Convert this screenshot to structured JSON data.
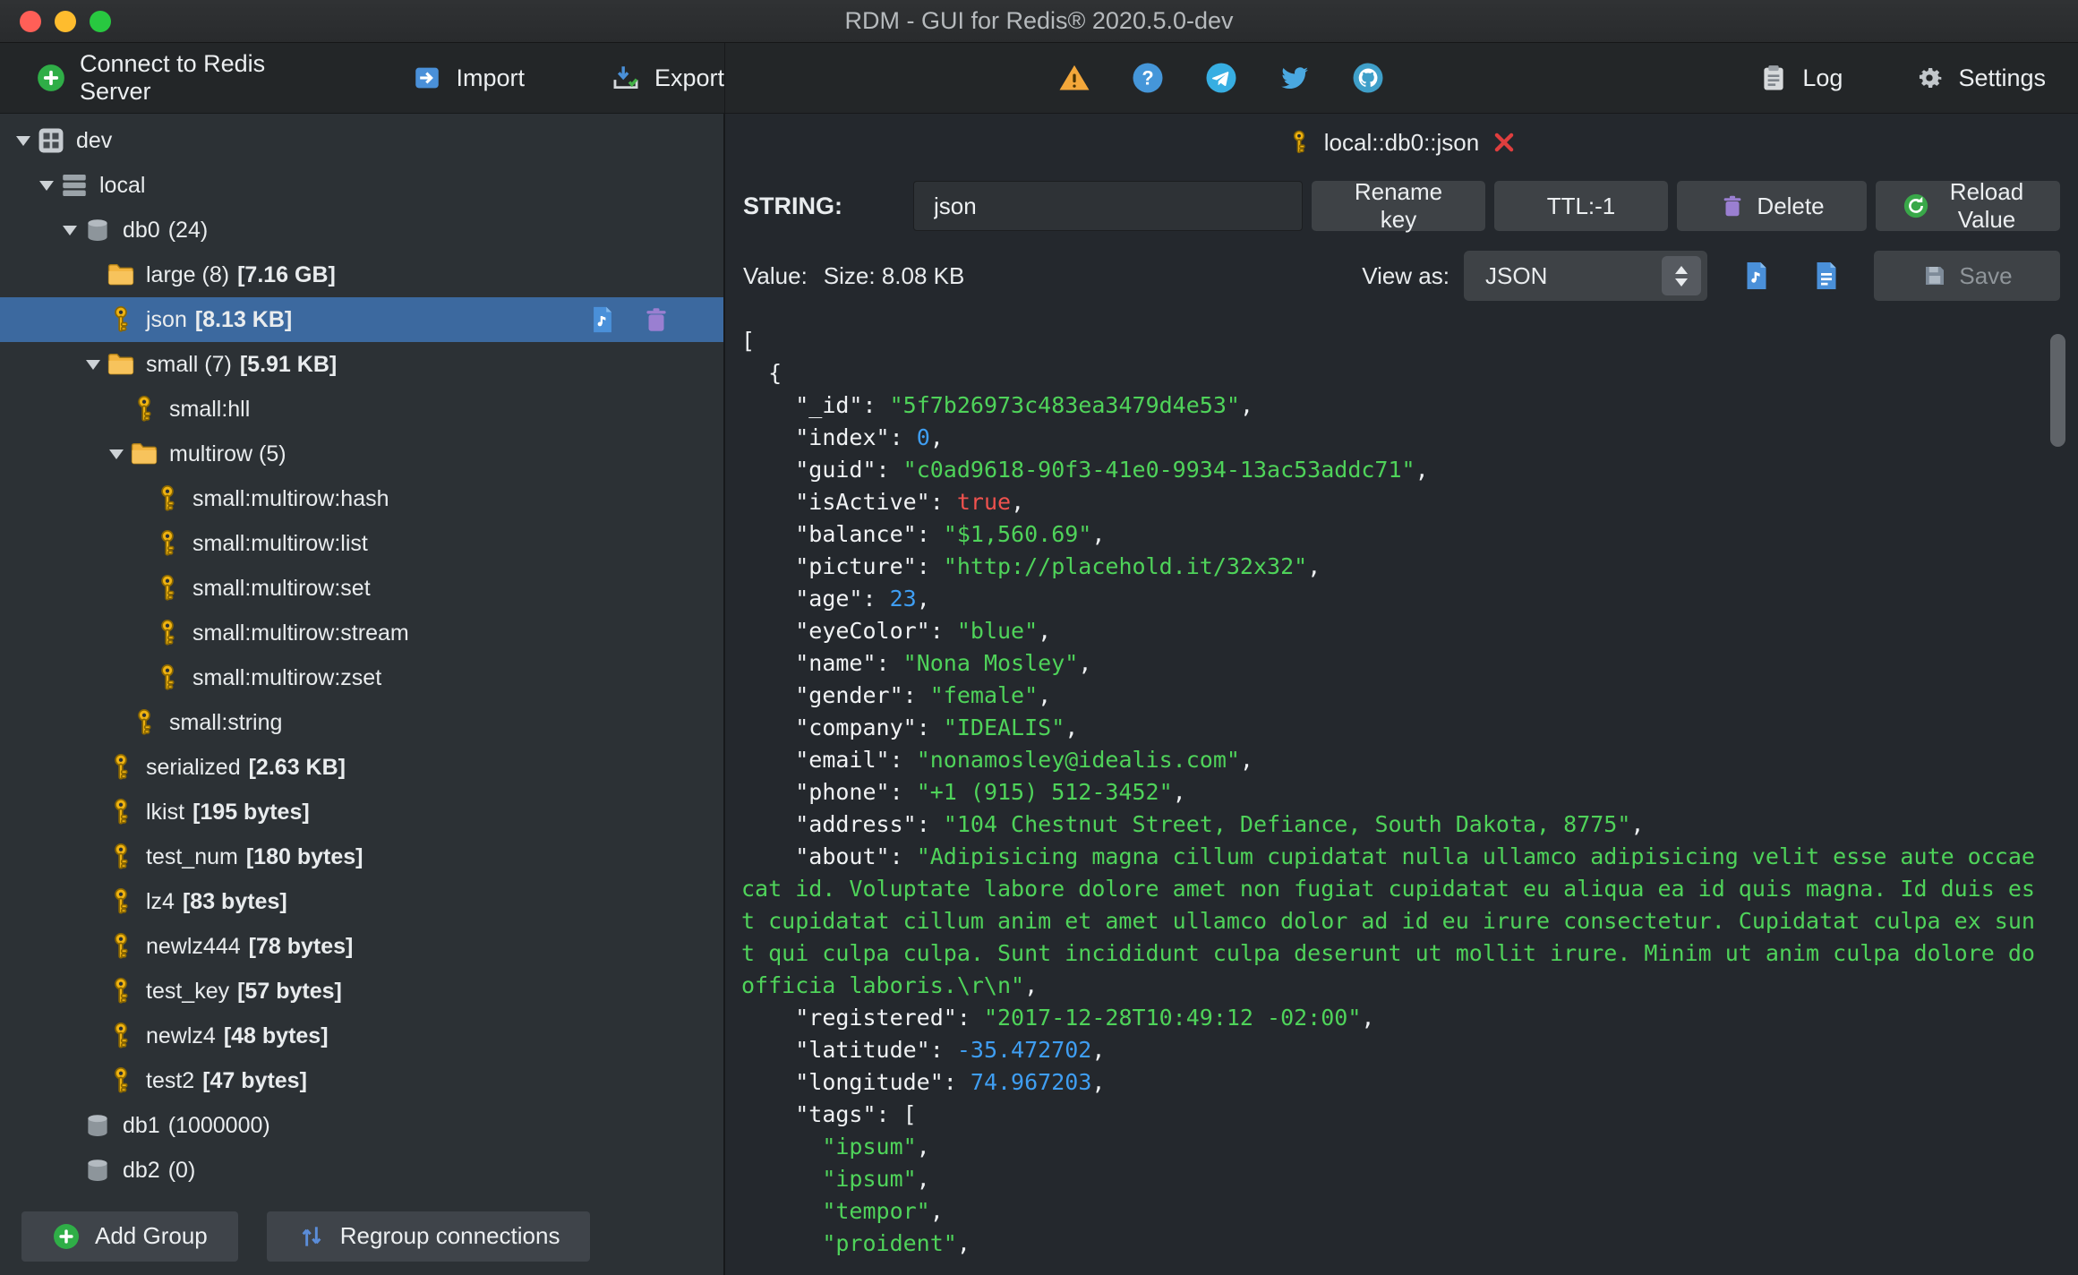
{
  "window": {
    "title": "RDM - GUI for Redis® 2020.5.0-dev"
  },
  "colors": {
    "selection": "#3c699f",
    "json_string": "#4fd35a",
    "json_number": "#3f9ef2",
    "json_boolean": "#f0524e",
    "key_icon_gold": "#eeb211",
    "trash_purple": "#9a7fd1",
    "accent_blue": "#4a90d9",
    "accent_green": "#2fae47"
  },
  "icons": {
    "plus-circle-icon": "+",
    "import-icon": "→",
    "export-icon": "↓✓",
    "warning-icon": "⚠",
    "help-icon": "?",
    "telegram-icon": "➤",
    "twitter-icon": "🐦",
    "github-icon": "octocat",
    "log-icon": "clipboard",
    "gear-icon": "⚙",
    "key-icon": "🔑",
    "folder-icon": "📁",
    "database-icon": "cylinder",
    "trash-icon": "🗑",
    "reload-icon": "↻",
    "save-icon": "💾",
    "close-icon": "✕",
    "stepper-icon": "⇅",
    "regroup-icon": "↑↓"
  },
  "toolbar": {
    "connect_label": "Connect to Redis Server",
    "import_label": "Import",
    "export_label": "Export",
    "log_label": "Log",
    "settings_label": "Settings"
  },
  "sidebar": {
    "tree": [
      {
        "level": 0,
        "arrow": "down",
        "icon": "grid",
        "label": "dev"
      },
      {
        "level": 1,
        "arrow": "down",
        "icon": "server",
        "label": "local"
      },
      {
        "level": 2,
        "arrow": "down",
        "icon": "db",
        "label": "db0",
        "count": "(24)"
      },
      {
        "level": 3,
        "arrow": "none",
        "icon": "folder",
        "label": "large (8)",
        "size": "[7.16 GB]"
      },
      {
        "level": 3,
        "arrow": "none",
        "icon": "key",
        "label": "json",
        "size": "[8.13 KB]",
        "selected": true
      },
      {
        "level": 3,
        "arrow": "down",
        "icon": "folder",
        "label": "small (7)",
        "size": "[5.91 KB]"
      },
      {
        "level": 4,
        "arrow": "none",
        "icon": "key",
        "label": "small:hll"
      },
      {
        "level": 4,
        "arrow": "down",
        "icon": "folder",
        "label": "multirow (5)"
      },
      {
        "level": 5,
        "arrow": "none",
        "icon": "key",
        "label": "small:multirow:hash"
      },
      {
        "level": 5,
        "arrow": "none",
        "icon": "key",
        "label": "small:multirow:list"
      },
      {
        "level": 5,
        "arrow": "none",
        "icon": "key",
        "label": "small:multirow:set"
      },
      {
        "level": 5,
        "arrow": "none",
        "icon": "key",
        "label": "small:multirow:stream"
      },
      {
        "level": 5,
        "arrow": "none",
        "icon": "key",
        "label": "small:multirow:zset"
      },
      {
        "level": 4,
        "arrow": "none",
        "icon": "key",
        "label": "small:string"
      },
      {
        "level": 3,
        "arrow": "none",
        "icon": "key",
        "label": "serialized",
        "size": "[2.63 KB]"
      },
      {
        "level": 3,
        "arrow": "none",
        "icon": "key",
        "label": "lkist",
        "size": "[195 bytes]"
      },
      {
        "level": 3,
        "arrow": "none",
        "icon": "key",
        "label": "test_num",
        "size": "[180 bytes]"
      },
      {
        "level": 3,
        "arrow": "none",
        "icon": "key",
        "label": "lz4",
        "size": "[83 bytes]"
      },
      {
        "level": 3,
        "arrow": "none",
        "icon": "key",
        "label": "newlz444",
        "size": "[78 bytes]"
      },
      {
        "level": 3,
        "arrow": "none",
        "icon": "key",
        "label": "test_key",
        "size": "[57 bytes]"
      },
      {
        "level": 3,
        "arrow": "none",
        "icon": "key",
        "label": "newlz4",
        "size": "[48 bytes]"
      },
      {
        "level": 3,
        "arrow": "none",
        "icon": "key",
        "label": "test2",
        "size": "[47 bytes]"
      },
      {
        "level": 2,
        "arrow": "none",
        "icon": "db",
        "label": "db1",
        "count": "(1000000)"
      },
      {
        "level": 2,
        "arrow": "none",
        "icon": "db",
        "label": "db2",
        "count": "(0)"
      }
    ],
    "add_group_label": "Add Group",
    "regroup_label": "Regroup connections"
  },
  "main": {
    "tab_title": "local::db0::json",
    "key_type": "STRING:",
    "key_name": "json",
    "rename_label": "Rename key",
    "ttl_label": "TTL:-1",
    "delete_label": "Delete",
    "reload_label": "Reload Value",
    "value_label": "Value:",
    "size_label": "Size: 8.08 KB",
    "view_as_label": "View as:",
    "view_mode": "JSON",
    "save_label": "Save"
  },
  "editor": {
    "lines": [
      "[",
      "  {",
      "    \"_id\": \"5f7b26973c483ea3479d4e53\",",
      "    \"index\": 0,",
      "    \"guid\": \"c0ad9618-90f3-41e0-9934-13ac53addc71\",",
      "    \"isActive\": true,",
      "    \"balance\": \"$1,560.69\",",
      "    \"picture\": \"http://placehold.it/32x32\",",
      "    \"age\": 23,",
      "    \"eyeColor\": \"blue\",",
      "    \"name\": \"Nona Mosley\",",
      "    \"gender\": \"female\",",
      "    \"company\": \"IDEALIS\",",
      "    \"email\": \"nonamosley@idealis.com\",",
      "    \"phone\": \"+1 (915) 512-3452\",",
      "    \"address\": \"104 Chestnut Street, Defiance, South Dakota, 8775\",",
      "    \"about\": \"Adipisicing magna cillum cupidatat nulla ullamco adipisicing velit esse aute occaecat id. Voluptate labore dolore amet non fugiat cupidatat eu aliqua ea id quis magna. Id duis est cupidatat cillum anim et amet ullamco dolor ad id eu irure consectetur. Cupidatat culpa ex sunt qui culpa culpa. Sunt incididunt culpa deserunt ut mollit irure. Minim ut anim culpa dolore do officia laboris.\\r\\n\",",
      "    \"registered\": \"2017-12-28T10:49:12 -02:00\",",
      "    \"latitude\": -35.472702,",
      "    \"longitude\": 74.967203,",
      "    \"tags\": [",
      "      \"ipsum\",",
      "      \"ipsum\",",
      "      \"tempor\",",
      "      \"proident\","
    ]
  }
}
